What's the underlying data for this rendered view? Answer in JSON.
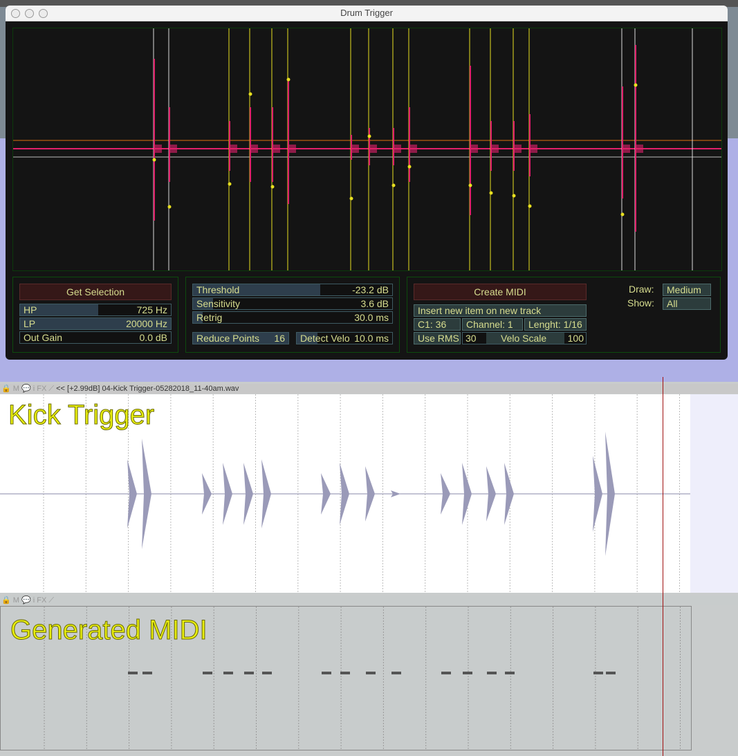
{
  "window": {
    "title": "Drum Trigger"
  },
  "filter_panel": {
    "get_selection": "Get Selection",
    "hp": {
      "label": "HP",
      "value": "725 Hz",
      "fill": 0.52
    },
    "lp": {
      "label": "LP",
      "value": "20000 Hz",
      "fill": 1.0
    },
    "out_gain": {
      "label": "Out Gain",
      "value": "0.0 dB",
      "fill": 0.0
    }
  },
  "detect_panel": {
    "threshold": {
      "label": "Threshold",
      "value": "-23.2 dB",
      "fill": 0.65
    },
    "sensitivity": {
      "label": "Sensitivity",
      "value": "3.6 dB",
      "fill": 0.1
    },
    "retrig": {
      "label": "Retrig",
      "value": "30.0 ms",
      "fill": 0.05
    },
    "reduce_points": {
      "label": "Reduce Points",
      "value": "16"
    },
    "detect_velo": {
      "label": "Detect Velo",
      "value": "10.0 ms"
    }
  },
  "midi_panel": {
    "create_midi": "Create MIDI",
    "insert_mode": "Insert new item on new track",
    "note": "C1: 36",
    "channel": "Channel: 1",
    "length": "Lenght: 1/16",
    "use_rms": "Use RMS",
    "velo_min": "30",
    "velo_scale": "Velo Scale",
    "velo_max": "100"
  },
  "display": {
    "draw_label": "Draw:",
    "draw_value": "Medium",
    "show_label": "Show:",
    "show_value": "All"
  },
  "tracks": {
    "kick_header": "<< [+2.99dB] 04-Kick Trigger-05282018_11-40am.wav",
    "kick_name": "Kick Trigger",
    "midi_name": "Generated MIDI",
    "header_icons": [
      "lock-icon",
      "M",
      "comment-icon",
      "i",
      "FX",
      "envelope-icon"
    ]
  },
  "colors": {
    "waveform": "#e0206a",
    "threshold_line": "#e07010",
    "trigger_line": "#e8e020",
    "label": "#d6dc8e",
    "button": "#351818"
  }
}
